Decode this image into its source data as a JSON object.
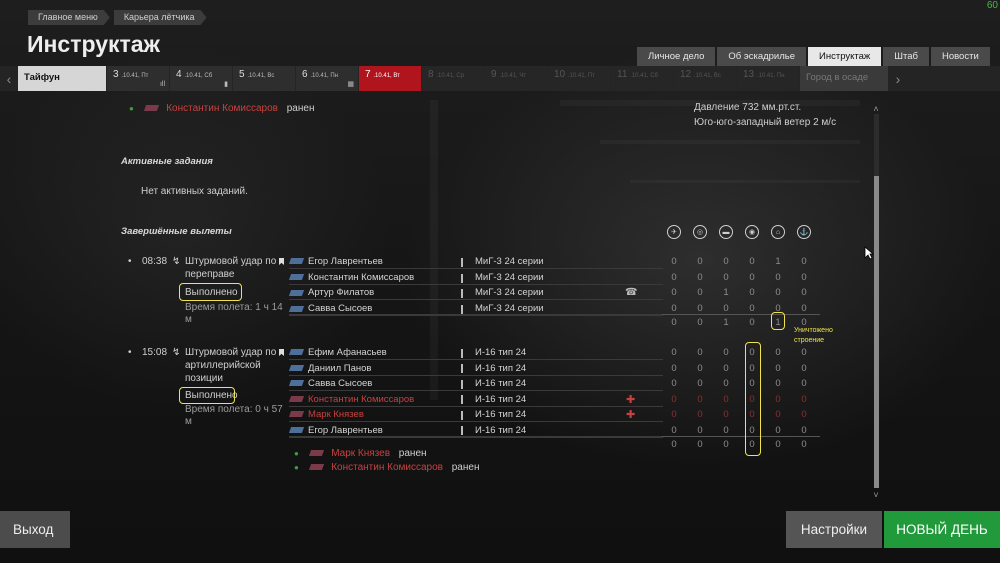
{
  "fps": "60",
  "breadcrumbs": [
    "Главное меню",
    "Карьера лётчика"
  ],
  "page_title": "Инструктаж",
  "tabs": [
    {
      "label": "Личное дело",
      "active": false
    },
    {
      "label": "Об эскадрилье",
      "active": false
    },
    {
      "label": "Инструктаж",
      "active": true
    },
    {
      "label": "Штаб",
      "active": false
    },
    {
      "label": "Новости",
      "active": false
    }
  ],
  "daybar": {
    "first": "Тайфун",
    "days": [
      {
        "num": "3",
        "date": ".10.41, Пт",
        "icon": "ıll"
      },
      {
        "num": "4",
        "date": ".10.41, Сб",
        "icon": "▮"
      },
      {
        "num": "5",
        "date": ".10.41, Вс",
        "icon": ""
      },
      {
        "num": "6",
        "date": ".10.41, Пн",
        "icon": "▦"
      },
      {
        "num": "7",
        "date": ".10.41, Вт",
        "icon": "",
        "current": true
      },
      {
        "num": "8",
        "date": ".10.41, Ср",
        "dim": true
      },
      {
        "num": "9",
        "date": ".10.41, Чт",
        "dim": true
      },
      {
        "num": "10",
        "date": ".10.41, Пт",
        "dim": true
      },
      {
        "num": "11",
        "date": ".10.41, Сб",
        "dim": true
      },
      {
        "num": "12",
        "date": ".10.41, Вс",
        "dim": true
      },
      {
        "num": "13",
        "date": ".10.41, Пн",
        "dim": true
      }
    ],
    "last": "Город в осаде"
  },
  "top_wounded": {
    "name": "Константин Комиссаров",
    "status": "ранен"
  },
  "weather": {
    "pressure": "Давление 732 мм.рт.ст.",
    "wind": "Юго-юго-западный ветер 2 м/с"
  },
  "active_tasks": {
    "header": "Активные задания",
    "empty": "Нет активных заданий."
  },
  "completed": {
    "header": "Завершённые вылеты"
  },
  "stat_icons": [
    "plane-kill-icon",
    "ground-target-icon",
    "vehicle-icon",
    "artillery-icon",
    "building-icon",
    "ship-icon"
  ],
  "sorties": [
    {
      "time": "08:38",
      "mission_line1": "Штурмовой удар по",
      "mission_line2": "переправе",
      "status": "Выполнено",
      "flight_time_1": "Время полета: 1 ч 14",
      "flight_time_2": "м",
      "pilots": [
        {
          "name": "Егор Лаврентьев",
          "aircraft": "МиГ-3 24 серии",
          "stats": [
            "0",
            "0",
            "0",
            "0",
            "1",
            "0"
          ]
        },
        {
          "name": "Константин Комиссаров",
          "aircraft": "МиГ-3 24 серии",
          "stats": [
            "0",
            "0",
            "0",
            "0",
            "0",
            "0"
          ]
        },
        {
          "name": "Артур Филатов",
          "aircraft": "МиГ-3 24 серии",
          "stats": [
            "0",
            "0",
            "1",
            "0",
            "0",
            "0"
          ],
          "extra": "☎"
        },
        {
          "name": "Савва Сысоев",
          "aircraft": "МиГ-3 24 серии",
          "stats": [
            "0",
            "0",
            "0",
            "0",
            "0",
            "0"
          ]
        }
      ],
      "totals": [
        "0",
        "0",
        "1",
        "0",
        "1",
        "0"
      ],
      "note_line1": "Уничтожено",
      "note_line2": "строение"
    },
    {
      "time": "15:08",
      "mission_line1": "Штурмовой удар по",
      "mission_line2": "артиллерийской",
      "mission_line3": "позиции",
      "status": "Выполнено",
      "flight_time_1": "Время полета: 0 ч 57",
      "flight_time_2": "м",
      "pilots": [
        {
          "name": "Ефим Афанасьев",
          "aircraft": "И-16 тип 24",
          "stats": [
            "0",
            "0",
            "0",
            "0",
            "0",
            "0"
          ]
        },
        {
          "name": "Даниил Панов",
          "aircraft": "И-16 тип 24",
          "stats": [
            "0",
            "0",
            "0",
            "0",
            "0",
            "0"
          ]
        },
        {
          "name": "Савва Сысоев",
          "aircraft": "И-16 тип 24",
          "stats": [
            "0",
            "0",
            "0",
            "0",
            "0",
            "0"
          ]
        },
        {
          "name": "Константин Комиссаров",
          "aircraft": "И-16 тип 24",
          "stats": [
            "0",
            "0",
            "0",
            "0",
            "0",
            "0"
          ],
          "wounded": true
        },
        {
          "name": "Марк Князев",
          "aircraft": "И-16 тип 24",
          "stats": [
            "0",
            "0",
            "0",
            "0",
            "0",
            "0"
          ],
          "wounded": true
        },
        {
          "name": "Егор Лаврентьев",
          "aircraft": "И-16 тип 24",
          "stats": [
            "0",
            "0",
            "0",
            "0",
            "0",
            "0"
          ]
        }
      ],
      "totals": [
        "0",
        "0",
        "0",
        "0",
        "0",
        "0"
      ],
      "wounded_list": [
        {
          "name": "Марк Князев",
          "status": "ранен"
        },
        {
          "name": "Константин Комиссаров",
          "status": "ранен"
        }
      ]
    }
  ],
  "buttons": {
    "exit": "Выход",
    "settings": "Настройки",
    "new_day": "НОВЫЙ ДЕНЬ"
  },
  "colors": {
    "current_day": "#b0141c",
    "new_day": "#219a3c",
    "wounded": "#c9413f",
    "highlight": "#f2e34a"
  }
}
